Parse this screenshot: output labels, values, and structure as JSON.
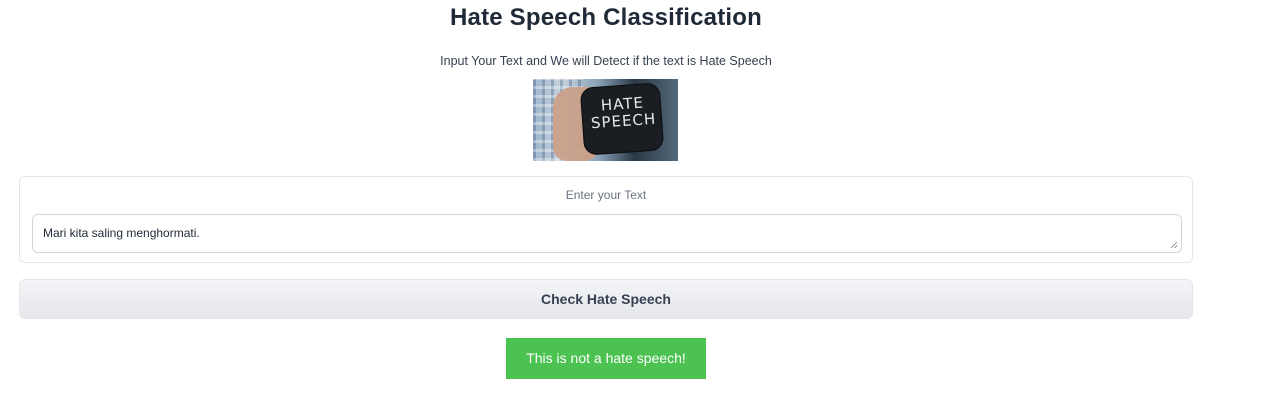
{
  "header": {
    "title": "Hate Speech Classification",
    "subtitle": "Input Your Text and We will Detect if the text is Hate Speech"
  },
  "hero_image": {
    "chalk_line1": "HATE",
    "chalk_line2": "SPEECH"
  },
  "input": {
    "label": "Enter your Text",
    "value": "Mari kita saling menghormati."
  },
  "actions": {
    "check_label": "Check Hate Speech"
  },
  "result": {
    "text": "This is not a hate speech!",
    "color": "#4cc251"
  }
}
